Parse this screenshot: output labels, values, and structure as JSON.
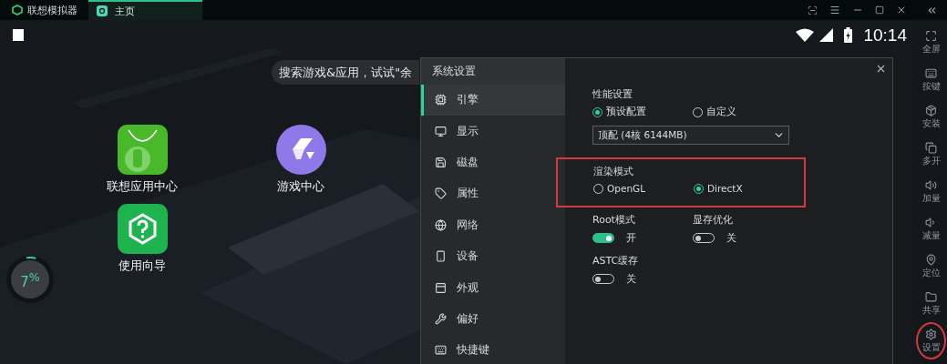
{
  "titlebar": {
    "app_name": "联想模拟器",
    "tabs": [
      {
        "label": "主页",
        "selected": true
      }
    ]
  },
  "status_bar": {
    "time": "10:14"
  },
  "search": {
    "placeholder": "搜索游戏&应用，试试\"余"
  },
  "apps": [
    {
      "label": "联想应用中心",
      "kind": "store"
    },
    {
      "label": "游戏中心",
      "kind": "games"
    },
    {
      "label": "使用向导",
      "kind": "guide"
    }
  ],
  "float_ball": {
    "reading": "7$^{%}$",
    "level": 0.07
  },
  "dialog": {
    "title": "系统设置",
    "nav": [
      {
        "label": "引擎",
        "selected": true
      },
      {
        "label": "显示",
        "selected": false
      },
      {
        "label": "磁盘",
        "selected": false
      },
      {
        "label": "属性",
        "selected": false
      },
      {
        "label": "网络",
        "selected": false
      },
      {
        "label": "设备",
        "selected": false
      },
      {
        "label": "外观",
        "selected": false
      },
      {
        "label": "偏好",
        "selected": false
      },
      {
        "label": "快捷键",
        "selected": false
      }
    ],
    "performance": {
      "heading": "性能设置",
      "options": [
        {
          "label": "预设配置",
          "selected": true
        },
        {
          "label": "自定义",
          "selected": false
        }
      ],
      "preset": "顶配 (4核 6144MB)"
    },
    "render": {
      "heading": "渲染模式",
      "highlighted": true,
      "options": [
        {
          "label": "OpenGL",
          "selected": false
        },
        {
          "label": "DirectX",
          "selected": true
        }
      ]
    },
    "toggles": [
      {
        "label": "Root模式",
        "on": true,
        "state": "开"
      },
      {
        "label": "显存优化",
        "on": false,
        "state": "关"
      },
      {
        "label": "ASTC缓存",
        "on": false,
        "state": "关"
      }
    ]
  },
  "toolbar": [
    {
      "label": "全屏",
      "highlighted": false
    },
    {
      "label": "按键",
      "highlighted": false
    },
    {
      "label": "安装",
      "highlighted": false
    },
    {
      "label": "多开",
      "highlighted": false
    },
    {
      "label": "加量",
      "highlighted": false
    },
    {
      "label": "减量",
      "highlighted": false
    },
    {
      "label": "定位",
      "highlighted": false
    },
    {
      "label": "共享",
      "highlighted": false
    },
    {
      "label": "设置",
      "highlighted": true
    }
  ]
}
